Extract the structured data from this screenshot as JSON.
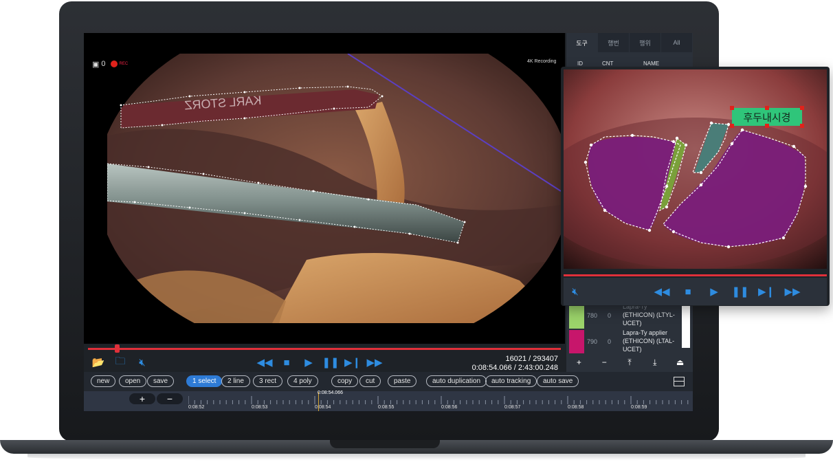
{
  "video": {
    "rec_count": "0",
    "rec_label": "REC",
    "k4_label": "4K Recording",
    "frame_counter": "16021 / 293407",
    "time_counter": "0:08:54.066 / 2:43:00.248"
  },
  "scene_text": {
    "instrument_print": "KARL STORZ"
  },
  "toolbar": {
    "buttons": [
      "new",
      "open",
      "save",
      "1 select",
      "2 line",
      "3 rect",
      "4 poly",
      "copy",
      "cut",
      "paste",
      "auto duplication",
      "auto tracking",
      "auto save"
    ],
    "active": "1 select"
  },
  "timeline": {
    "cursor_time": "0:08:54.066",
    "ticks": [
      "0:08:52",
      "0:08:53",
      "0:08:54",
      "0:08:55",
      "0:08:56",
      "0:08:57",
      "0:08:58",
      "0:08:59"
    ]
  },
  "panel": {
    "tabs": [
      "도구",
      "행번",
      "행위",
      "All"
    ],
    "selected_tab": "도구",
    "columns": [
      "ID",
      "CNT",
      "NAME"
    ],
    "rows": [
      {
        "id": "780",
        "cnt": "0",
        "name": "Lapra-Ty (ETHICON) (LTYL-UCET)",
        "color": "#9bd36a"
      },
      {
        "id": "790",
        "cnt": "0",
        "name": "Lapra-Ty applier (ETHICON) (LTAL-UCET)",
        "color": "#c7166b"
      }
    ],
    "row_0_top": "Lapra-Ty",
    "row_0_mid": "(ETHICON) (LTYL-",
    "row_0_end": "UCET)",
    "row_1_top": "Lapra-Ty applier",
    "row_1_mid": "(ETHICON) (LTAL-",
    "row_1_end": "UCET)"
  },
  "popup": {
    "label_tag": "후두내시경"
  },
  "colors": {
    "accent": "#2e8ce0",
    "progress": "#e0303a",
    "active_pill": "#2e7bd6",
    "tag": "#2fc57a"
  }
}
